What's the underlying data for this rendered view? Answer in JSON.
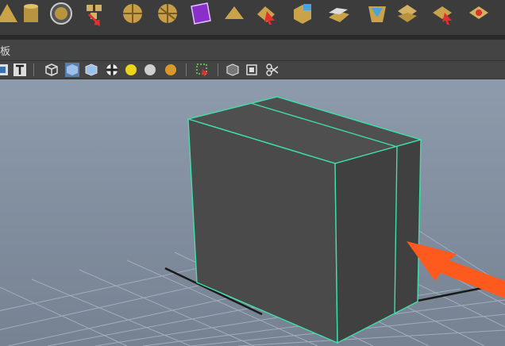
{
  "menu": {
    "label": "板"
  },
  "shelf_icons": [
    "cone-icon",
    "cylinder-icon",
    "sphere-circle-icon",
    "uv-layout-icon",
    "rotate-arrow-icon",
    "soccer-ball-icon",
    "soccer-ball-icon-2",
    "purple-cube-icon",
    "plane-icon",
    "select-arrow-icon",
    "cube-tools-icon",
    "flat-panel-icon",
    "split-plane-icon",
    "pyramid-icon",
    "cube-split-icon",
    "cube-arrow-icon",
    "cube-red-icon"
  ],
  "toolbar_icons": [
    "uv-icon",
    "text-icon",
    "wireframe-cube-icon",
    "shaded-cube-icon",
    "textured-cube-icon",
    "checker-icon",
    "light-yellow-icon",
    "sphere-grey-icon",
    "sphere-gold-icon",
    "select-region-icon",
    "cube-outline-icon",
    "isolate-icon",
    "snapshot-icon"
  ],
  "colors": {
    "background_top": "#8d9bac",
    "background_bottom": "#768292",
    "mesh_face": "#4a4a4a",
    "mesh_edge": "#3ee0a8",
    "arrow": "#ff5a1e",
    "grid": "#a8b4c2"
  }
}
